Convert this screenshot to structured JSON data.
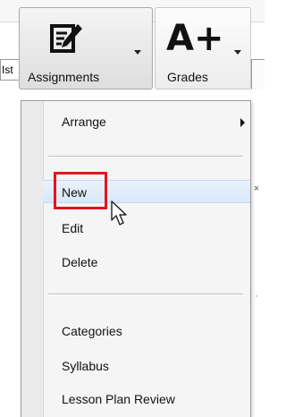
{
  "background": {
    "left_field_text": "Ist"
  },
  "toolbar": {
    "assignments_label": "Assignments",
    "grades_label": "Grades",
    "grades_icon_text": "A+"
  },
  "menu": {
    "items": [
      {
        "label": "Arrange",
        "has_submenu": true
      },
      {
        "label": "New",
        "state": "hovered",
        "highlighted": true
      },
      {
        "label": "Edit"
      },
      {
        "label": "Delete"
      },
      {
        "label": "Categories"
      },
      {
        "label": "Syllabus"
      },
      {
        "label": "Lesson Plan Review"
      }
    ]
  },
  "colors": {
    "highlight": "#e4151f",
    "hover_bg": "#d8e8f8",
    "menu_bg": "#f5f5f5"
  }
}
